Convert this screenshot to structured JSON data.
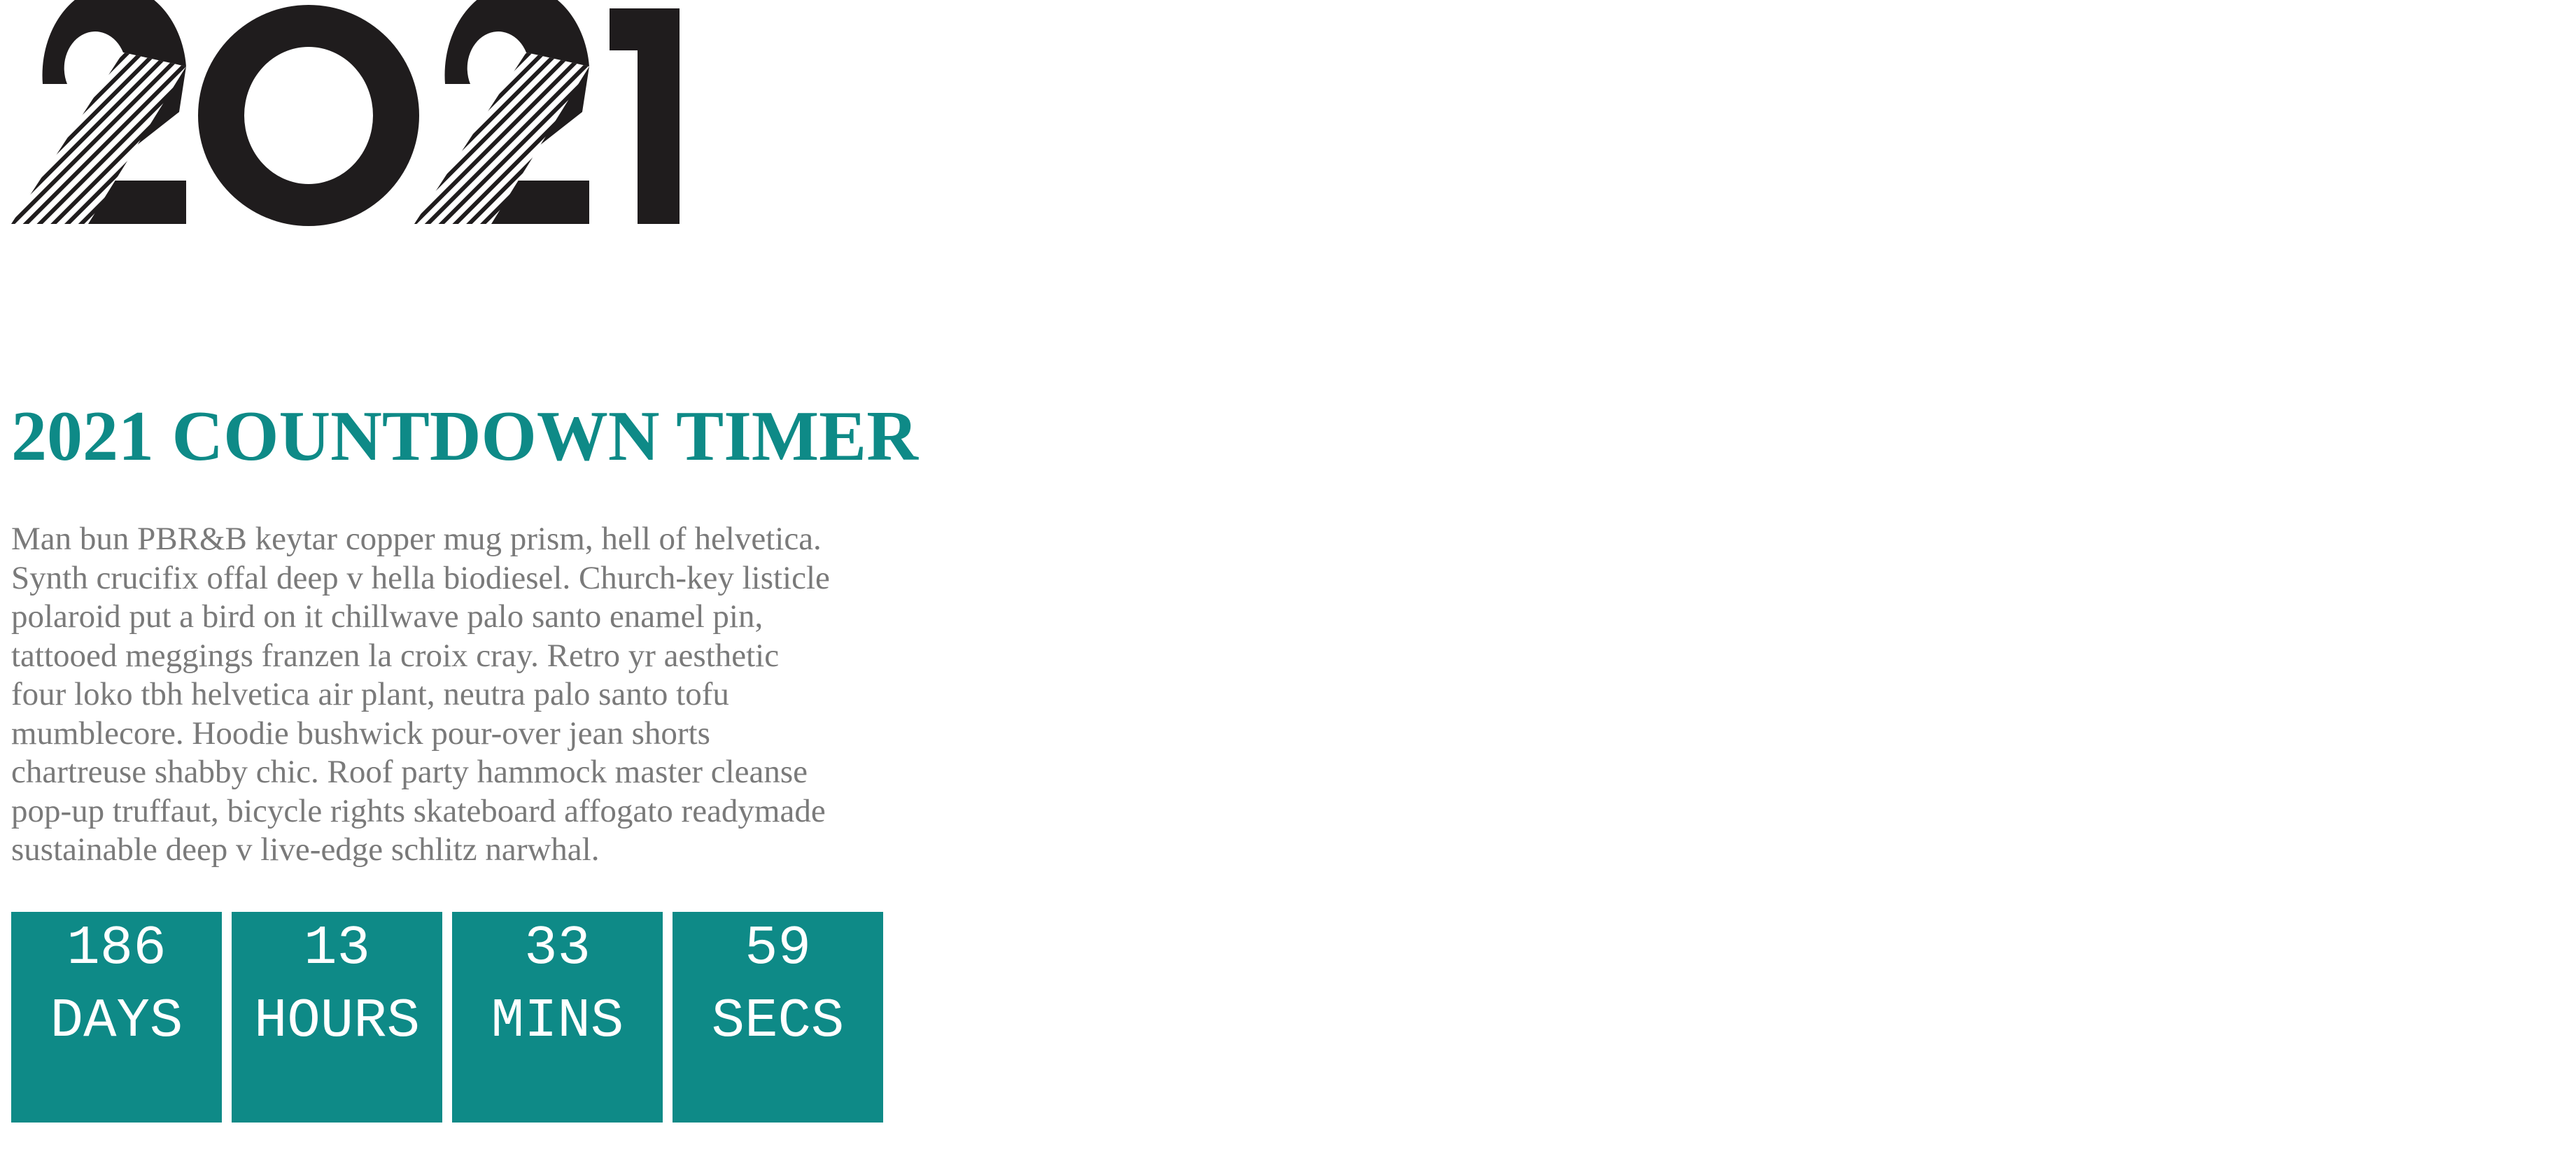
{
  "logo": {
    "text": "2021",
    "icon": "year-2021-logo"
  },
  "title": "2021 COUNTDOWN TIMER",
  "intro_lines": [
    "Man bun PBR&B keytar copper mug prism, hell of helvetica.",
    "Synth crucifix offal deep v hella biodiesel. Church-key listicle",
    "polaroid put a bird on it chillwave palo santo enamel pin,",
    "tattooed meggings franzen la croix cray. Retro yr aesthetic",
    "four loko tbh helvetica air plant, neutra palo santo tofu",
    "mumblecore. Hoodie bushwick pour-over jean shorts",
    "chartreuse shabby chic. Roof party hammock master cleanse",
    "pop-up truffaut, bicycle rights skateboard affogato readymade",
    "sustainable deep v live-edge schlitz narwhal."
  ],
  "countdown": [
    {
      "value": "186",
      "unit": "DAYS"
    },
    {
      "value": "13",
      "unit": "HOURS"
    },
    {
      "value": "33",
      "unit": "MINS"
    },
    {
      "value": "59",
      "unit": "SECS"
    }
  ],
  "colors": {
    "accent": "#0e8a87",
    "body_text": "#7a7a7a",
    "logo": "#1f1c1d"
  }
}
